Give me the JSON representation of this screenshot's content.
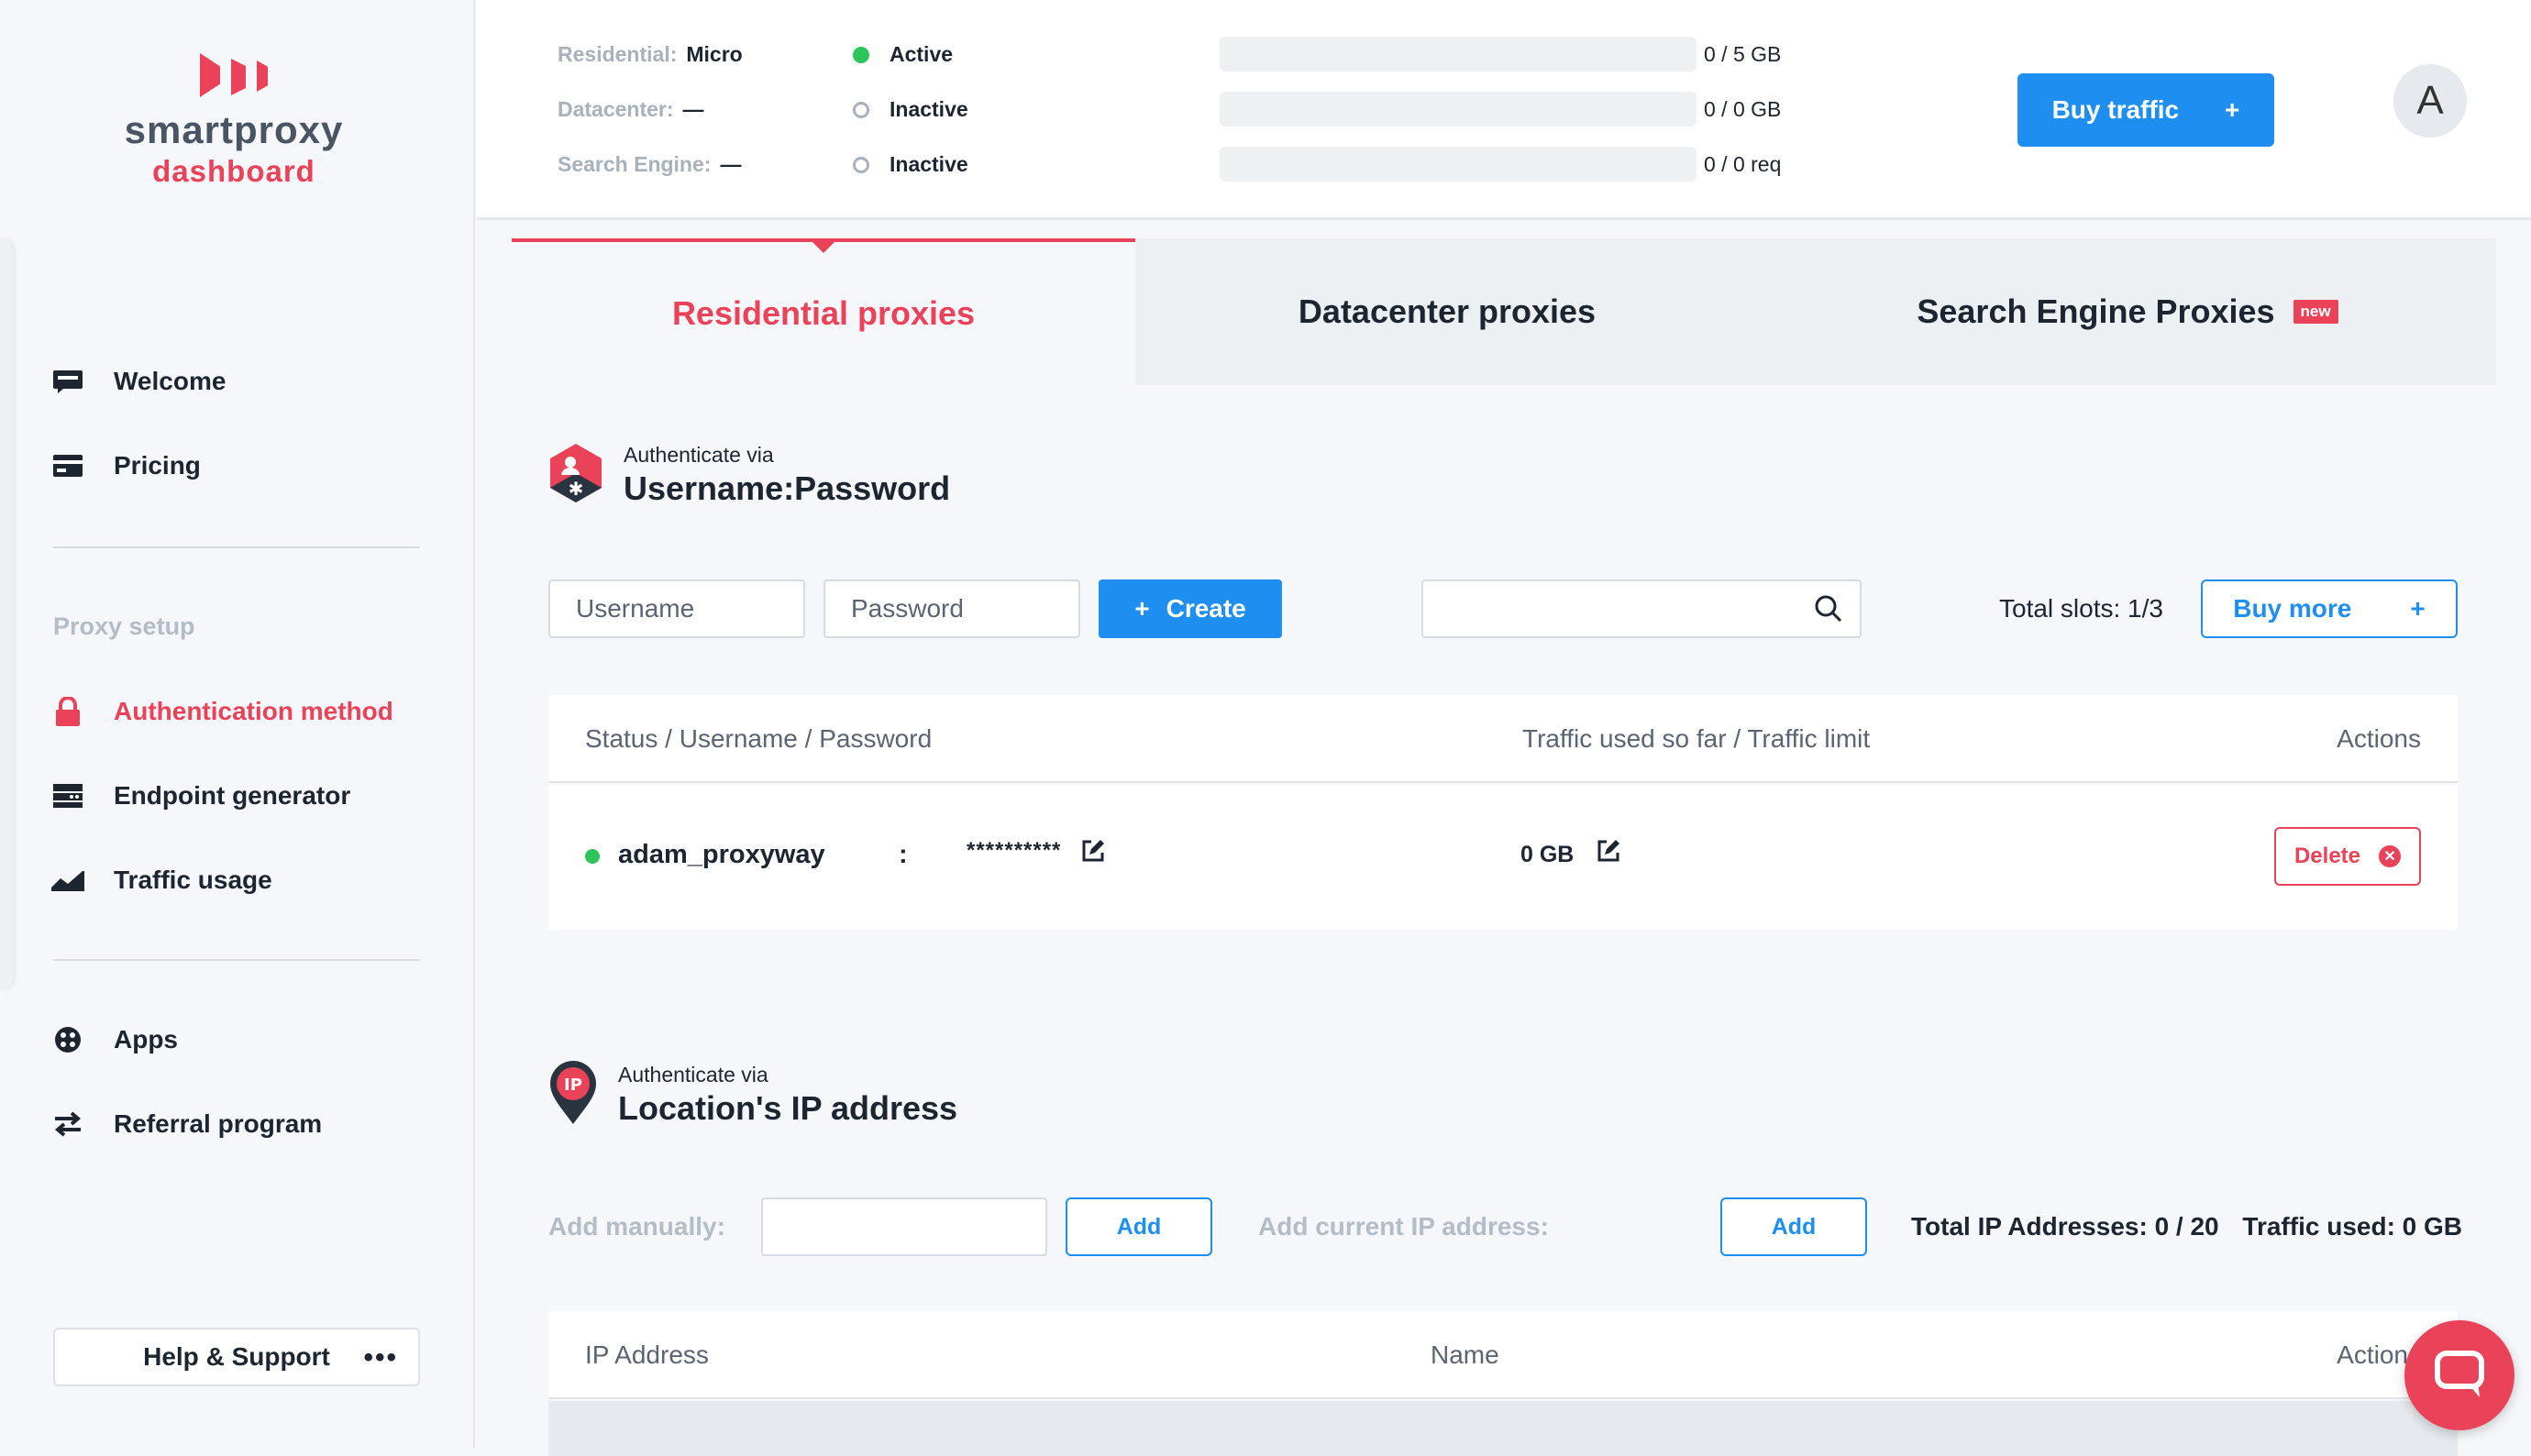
{
  "brand": {
    "name": "smartproxy",
    "subtitle": "dashboard"
  },
  "sidebar": {
    "items": [
      {
        "label": "Welcome",
        "icon": "welcome-icon"
      },
      {
        "label": "Pricing",
        "icon": "pricing-card-icon"
      }
    ],
    "section_title": "Proxy setup",
    "setup_items": [
      {
        "label": "Authentication method",
        "icon": "lock-icon",
        "active": true
      },
      {
        "label": "Endpoint generator",
        "icon": "endpoint-icon"
      },
      {
        "label": "Traffic usage",
        "icon": "chart-area-icon"
      }
    ],
    "extra_items": [
      {
        "label": "Apps",
        "icon": "apps-icon"
      },
      {
        "label": "Referral program",
        "icon": "swap-arrows-icon"
      }
    ],
    "help_label": "Help & Support",
    "help_more": "•••"
  },
  "topbar": {
    "plans": [
      {
        "label": "Residential:",
        "value": "Micro",
        "status": "Active",
        "active": true,
        "usage": "0 / 5 GB",
        "fill": 0
      },
      {
        "label": "Datacenter:",
        "value": "—",
        "status": "Inactive",
        "active": false,
        "usage": "0 / 0 GB",
        "fill": 0
      },
      {
        "label": "Search Engine:",
        "value": "—",
        "status": "Inactive",
        "active": false,
        "usage": "0 / 0 req",
        "fill": 0
      }
    ],
    "buy_traffic_label": "Buy traffic",
    "plus": "+",
    "avatar_initial": "A"
  },
  "tabs": [
    {
      "label": "Residential proxies"
    },
    {
      "label": "Datacenter proxies"
    },
    {
      "label": "Search Engine Proxies",
      "badge": "new"
    }
  ],
  "userpass": {
    "via": "Authenticate via",
    "title": "Username:Password",
    "username_placeholder": "Username",
    "password_placeholder": "Password",
    "create_label": "Create",
    "plus": "+",
    "search_value": "",
    "slots": "Total slots: 1/3",
    "buy_more_label": "Buy more",
    "columns": {
      "status": "Status / Username / Password",
      "traffic": "Traffic used so far / Traffic limit",
      "actions": "Actions"
    },
    "rows": [
      {
        "username": "adam_proxyway",
        "separator": ":",
        "password": "**********",
        "traffic": "0 GB",
        "delete_label": "Delete",
        "status_color": "#2ec45c"
      }
    ]
  },
  "ipauth": {
    "via": "Authenticate via",
    "title": "Location's IP address",
    "add_manually_label": "Add manually:",
    "add_label": "Add",
    "add_current_label": "Add current IP address:",
    "totals": "Total IP Addresses: 0 / 20",
    "traffic_used": "Traffic used: 0 GB",
    "columns": {
      "ip": "IP Address",
      "name": "Name",
      "actions": "Actions"
    }
  },
  "colors": {
    "accent": "#ea4258",
    "primary": "#1e8ff0",
    "active_green": "#2ec45c"
  }
}
